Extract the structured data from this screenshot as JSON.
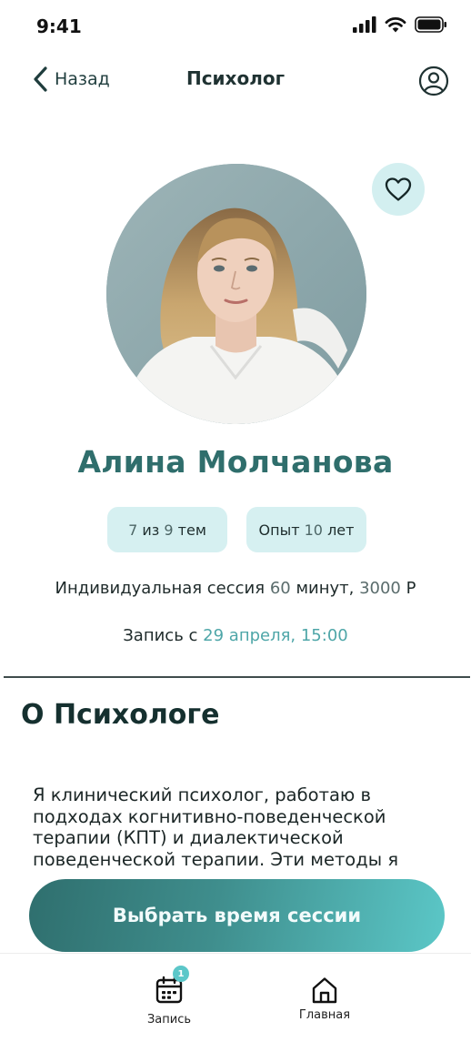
{
  "status_bar": {
    "time": "9:41"
  },
  "nav": {
    "back_label": "Назад",
    "title": "Психолог"
  },
  "profile": {
    "name": "Алина Молчанова",
    "topics": {
      "count": "7",
      "separator": " из ",
      "total": "9",
      "suffix": " тем"
    },
    "experience": {
      "prefix": "Опыт ",
      "years": "10",
      "suffix": " лет"
    },
    "session": {
      "prefix": "Индивидуальная сессия ",
      "minutes": "60",
      "mid": " минут, ",
      "price": "3000",
      "currency": " Р"
    },
    "booking": {
      "prefix": "Запись с ",
      "date": "29 апреля, 15:00"
    }
  },
  "about": {
    "title": "О Психологе",
    "text": "Я клинический психолог, работаю в подходах когнитивно-поведенческой терапии (КПТ) и диалектической поведенческой терапии. Эти методы я"
  },
  "cta": {
    "label": "Выбрать время сессии"
  },
  "tabbar": {
    "items": [
      {
        "label": "Запись",
        "icon": "calendar-icon",
        "badge": "1"
      },
      {
        "label": "Главная",
        "icon": "home-icon"
      }
    ]
  },
  "colors": {
    "accent": "#2f6e6c",
    "accent_light": "#d6f0f1",
    "link": "#4ea6a8",
    "badge": "#5cc7c9"
  }
}
